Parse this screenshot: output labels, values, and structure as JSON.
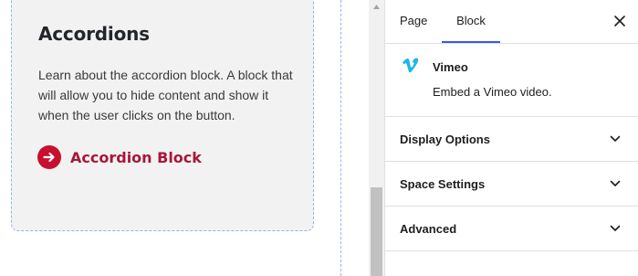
{
  "canvas": {
    "card": {
      "title": "Accordions",
      "description": "Learn about the accordion block. A block that will allow you to hide content and show it when the user clicks on the button.",
      "link_label": "Accordion Block",
      "link_icon": "arrow-right-circle-icon"
    }
  },
  "sidebar": {
    "tabs": [
      {
        "label": "Page",
        "active": false
      },
      {
        "label": "Block",
        "active": true
      }
    ],
    "close_icon": "close-icon",
    "block": {
      "icon": "vimeo-icon",
      "name": "Vimeo",
      "description": "Embed a Vimeo video."
    },
    "panels": [
      {
        "title": "Display Options",
        "expanded": false
      },
      {
        "title": "Space Settings",
        "expanded": false
      },
      {
        "title": "Advanced",
        "expanded": false
      }
    ]
  },
  "colors": {
    "accent": "#c8102e",
    "link_text": "#a8163a",
    "tab_underline": "#3858e9",
    "vimeo": "#1ab7ea",
    "card_background": "#f2f2f2",
    "guide_border": "#8fb7e8"
  }
}
